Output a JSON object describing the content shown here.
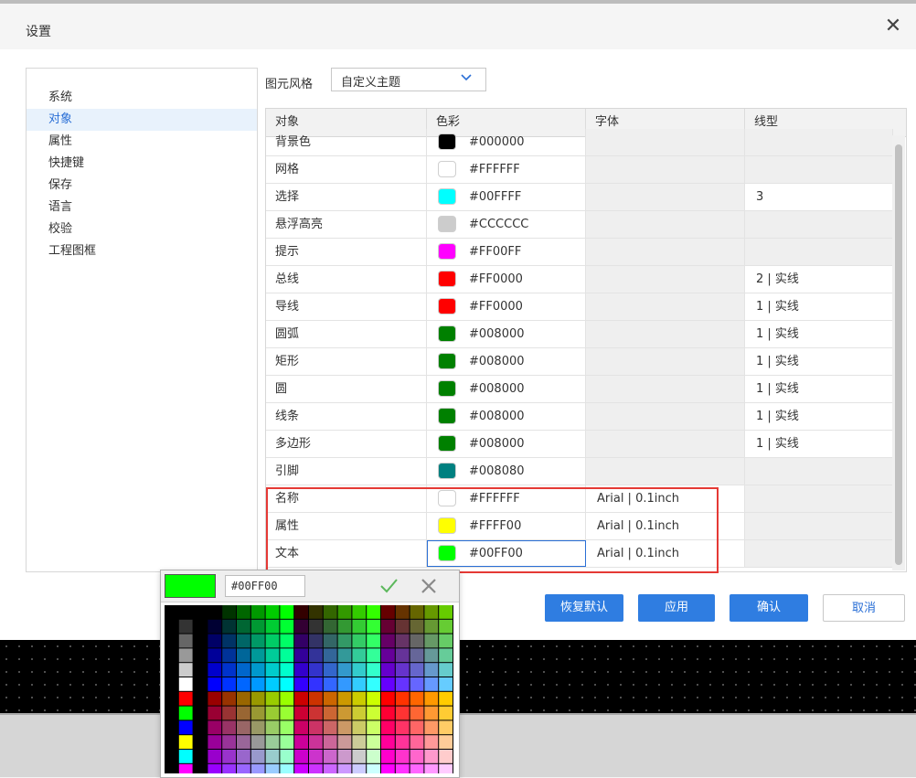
{
  "dialog": {
    "title": "设置",
    "close_label": "✕"
  },
  "nav": {
    "items": [
      {
        "label": "系统",
        "active": false
      },
      {
        "label": "对象",
        "active": true
      },
      {
        "label": "属性",
        "active": false
      },
      {
        "label": "快捷键",
        "active": false
      },
      {
        "label": "保存",
        "active": false
      },
      {
        "label": "语言",
        "active": false
      },
      {
        "label": "校验",
        "active": false
      },
      {
        "label": "工程图框",
        "active": false
      }
    ]
  },
  "style": {
    "label": "图元风格",
    "value": "自定义主题"
  },
  "table": {
    "headers": [
      "对象",
      "色彩",
      "字体",
      "线型"
    ],
    "rows": [
      {
        "name": "背景色",
        "color": "#000000",
        "hex": "#000000",
        "font": "",
        "line": ""
      },
      {
        "name": "网格",
        "color": "#FFFFFF",
        "hex": "#FFFFFF",
        "font": "",
        "line": ""
      },
      {
        "name": "选择",
        "color": "#00FFFF",
        "hex": "#00FFFF",
        "font": "",
        "line": "3"
      },
      {
        "name": "悬浮高亮",
        "color": "#CCCCCC",
        "hex": "#CCCCCC",
        "font": "",
        "line": ""
      },
      {
        "name": "提示",
        "color": "#FF00FF",
        "hex": "#FF00FF",
        "font": "",
        "line": ""
      },
      {
        "name": "总线",
        "color": "#FF0000",
        "hex": "#FF0000",
        "font": "",
        "line": "2 | 实线"
      },
      {
        "name": "导线",
        "color": "#FF0000",
        "hex": "#FF0000",
        "font": "",
        "line": "1 | 实线"
      },
      {
        "name": "圆弧",
        "color": "#008000",
        "hex": "#008000",
        "font": "",
        "line": "1 | 实线"
      },
      {
        "name": "矩形",
        "color": "#008000",
        "hex": "#008000",
        "font": "",
        "line": "1 | 实线"
      },
      {
        "name": "圆",
        "color": "#008000",
        "hex": "#008000",
        "font": "",
        "line": "1 | 实线"
      },
      {
        "name": "线条",
        "color": "#008000",
        "hex": "#008000",
        "font": "",
        "line": "1 | 实线"
      },
      {
        "name": "多边形",
        "color": "#008000",
        "hex": "#008000",
        "font": "",
        "line": "1 | 实线"
      },
      {
        "name": "引脚",
        "color": "#008080",
        "hex": "#008080",
        "font": "",
        "line": ""
      },
      {
        "name": "名称",
        "color": "#FFFFFF",
        "hex": "#FFFFFF",
        "font": "Arial | 0.1inch",
        "line": ""
      },
      {
        "name": "属性",
        "color": "#FFFF00",
        "hex": "#FFFF00",
        "font": "Arial | 0.1inch",
        "line": ""
      },
      {
        "name": "文本",
        "color": "#00FF00",
        "hex": "#00FF00",
        "font": "Arial | 0.1inch",
        "line": ""
      }
    ]
  },
  "buttons": {
    "restore": "恢复默认",
    "apply": "应用",
    "confirm": "确认",
    "cancel": "取消"
  },
  "picker": {
    "current_color": "#00FF00",
    "hex_value": "#00FF00",
    "ok_icon": "check-icon",
    "cancel_icon": "x-icon"
  },
  "colors": {
    "accent": "#2f7de1",
    "highlight_border": "#e53935"
  }
}
